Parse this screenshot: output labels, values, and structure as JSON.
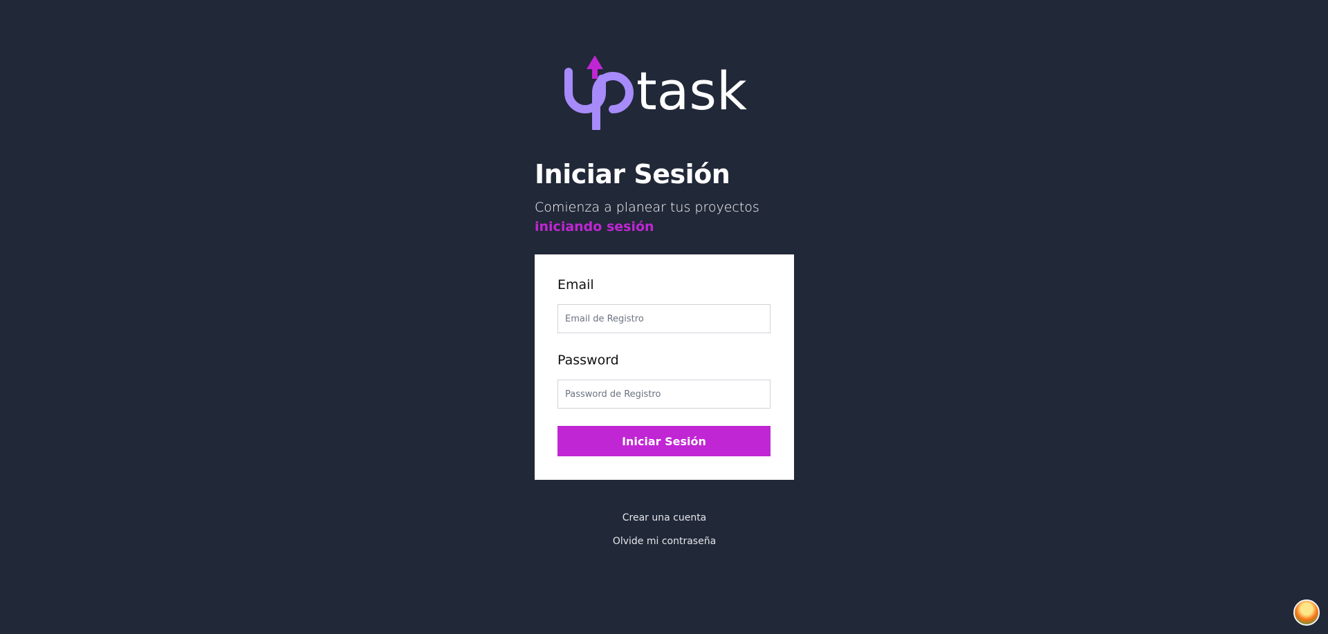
{
  "logo": {
    "text_part1": "up",
    "text_part2": "task",
    "colors": {
      "brand_purple": "#a78bfa",
      "arrow": "#c026d3",
      "text": "#ffffff"
    }
  },
  "header": {
    "title": "Iniciar Sesión",
    "subtitle": "Comienza a planear tus proyectos",
    "subtitle_accent": "iniciando sesión"
  },
  "form": {
    "email": {
      "label": "Email",
      "placeholder": "Email de Registro"
    },
    "password": {
      "label": "Password",
      "placeholder": "Password de Registro"
    },
    "submit_label": "Iniciar Sesión"
  },
  "links": {
    "create_account": "Crear una cuenta",
    "forgot_password": "Olvide mi contraseña"
  },
  "colors": {
    "background": "#212838",
    "accent": "#c026d3",
    "card": "#ffffff"
  },
  "icons": {
    "corner_badge": "beach-avatar-icon"
  }
}
